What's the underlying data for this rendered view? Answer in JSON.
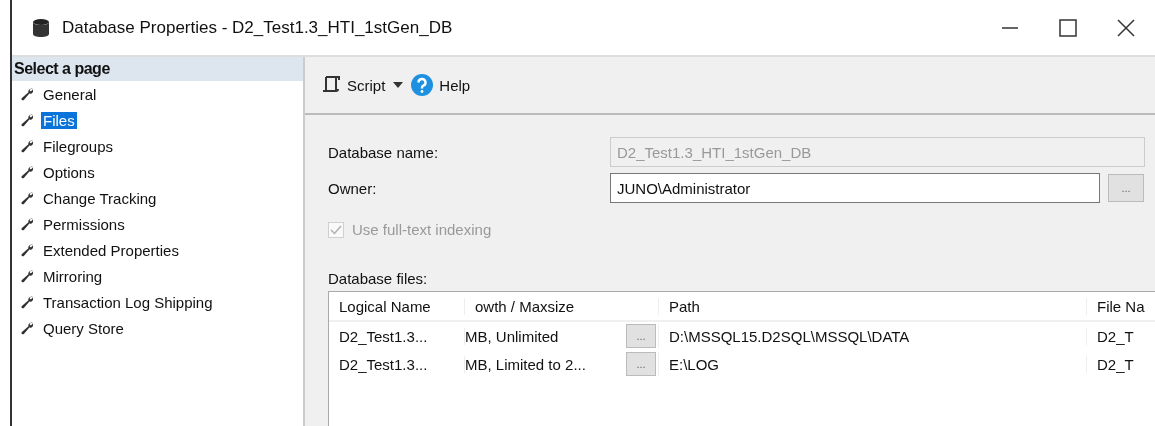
{
  "window": {
    "title": "Database Properties - D2_Test1.3_HTI_1stGen_DB"
  },
  "sidebar": {
    "header": "Select a page",
    "items": [
      {
        "label": "General",
        "selected": false
      },
      {
        "label": "Files",
        "selected": true
      },
      {
        "label": "Filegroups",
        "selected": false
      },
      {
        "label": "Options",
        "selected": false
      },
      {
        "label": "Change Tracking",
        "selected": false
      },
      {
        "label": "Permissions",
        "selected": false
      },
      {
        "label": "Extended Properties",
        "selected": false
      },
      {
        "label": "Mirroring",
        "selected": false
      },
      {
        "label": "Transaction Log Shipping",
        "selected": false
      },
      {
        "label": "Query Store",
        "selected": false
      }
    ]
  },
  "toolbar": {
    "script": "Script",
    "help": "Help"
  },
  "form": {
    "database_name": {
      "label": "Database name:",
      "value": "D2_Test1.3_HTI_1stGen_DB",
      "disabled": true
    },
    "owner": {
      "label": "Owner:",
      "value": "JUNO\\Administrator",
      "button": "..."
    },
    "fulltext": {
      "label": "Use full-text indexing",
      "checked": true,
      "disabled": true
    }
  },
  "files": {
    "label": "Database files:",
    "columns": [
      "Logical Name",
      "owth / Maxsize",
      "Path",
      "File Na"
    ],
    "rows": [
      {
        "logical_name": "D2_Test1.3...",
        "growth": "MB, Unlimited",
        "button": "...",
        "path": "D:\\MSSQL15.D2SQL\\MSSQL\\DATA",
        "file_name": "D2_T"
      },
      {
        "logical_name": "D2_Test1.3...",
        "growth": "MB, Limited to 2...",
        "button": "...",
        "path": "E:\\LOG",
        "file_name": "D2_T"
      }
    ]
  }
}
